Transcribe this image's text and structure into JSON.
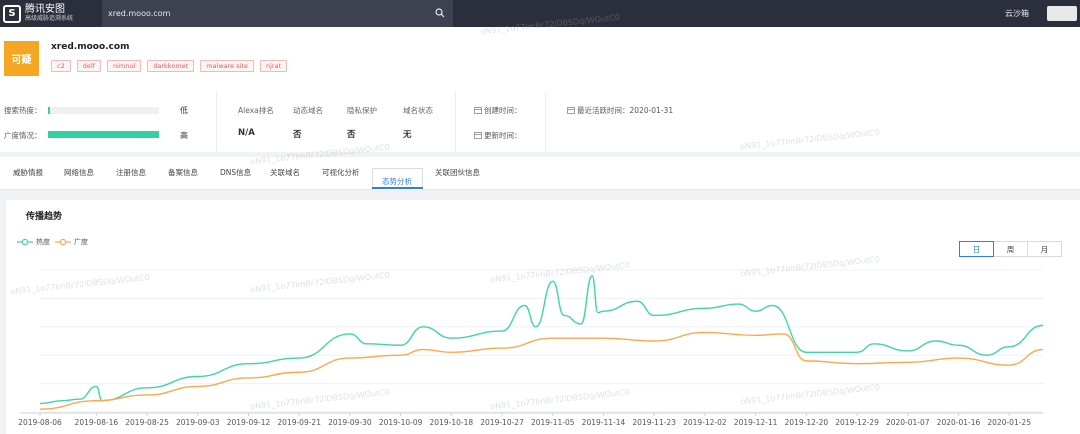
{
  "app": {
    "brand_mark": "S",
    "brand_name": "腾讯安图",
    "brand_sub": "高级威胁追溯系统",
    "search_value": "xred.mooo.com",
    "user_name": "云沙箱"
  },
  "header": {
    "verdict": "可疑",
    "domain": "xred.mooo.com",
    "tags": [
      "c2",
      "delf",
      "nimnul",
      "darkkomet",
      "malware site",
      "njrat"
    ]
  },
  "stats": {
    "search_heat_label": "搜索热度：",
    "search_heat_level": "低",
    "search_heat_fraction": 0.02,
    "spread_label": "广度情况：",
    "spread_level": "高",
    "spread_fraction": 1.0,
    "columns": [
      {
        "head": "Alexa排名",
        "value": "N/A"
      },
      {
        "head": "动态域名",
        "value": "否"
      },
      {
        "head": "隐私保护",
        "value": "否"
      },
      {
        "head": "域名状态",
        "value": "无"
      }
    ],
    "created_label": "创建时间：",
    "updated_label": "更新时间：",
    "last_active_label": "最近活跃时间：2020-01-31"
  },
  "tabs": [
    "威胁情报",
    "网络信息",
    "注册信息",
    "备案信息",
    "DNS信息",
    "关联域名",
    "可视化分析",
    "态势分析",
    "关联团伙信息"
  ],
  "active_tab": "态势分析",
  "panel": {
    "title": "传播趋势",
    "switch": [
      "日",
      "周",
      "月"
    ],
    "switch_active": "日"
  },
  "watermark": "oN91_1o77ImBr72lDBSDq/WOutC0",
  "colors": {
    "heat": "#3dd6a4",
    "breadth": "#ffa64d",
    "accent": "#2f7fe0",
    "verdict": "#f5a623"
  },
  "chart_data": {
    "type": "line",
    "x_ticks": [
      "2019-08-06",
      "2019-08-16",
      "2019-08-25",
      "2019-09-03",
      "2019-09-12",
      "2019-09-21",
      "2019-09-30",
      "2019-10-09",
      "2019-10-18",
      "2019-10-27",
      "2019-11-05",
      "2019-11-14",
      "2019-11-23",
      "2019-12-02",
      "2019-12-11",
      "2019-12-20",
      "2019-12-29",
      "2020-01-07",
      "2020-01-16",
      "2020-01-25"
    ],
    "x_start": "2019-08-06",
    "x_end": "2020-01-31",
    "grid": true,
    "ylim": [
      0,
      100
    ],
    "legend_position": "top-left",
    "series": [
      {
        "name": "热度",
        "color": "#3dd6a4",
        "points": [
          [
            "2019-08-06",
            6
          ],
          [
            "2019-08-10",
            8
          ],
          [
            "2019-08-13",
            9
          ],
          [
            "2019-08-16",
            18
          ],
          [
            "2019-08-17",
            8
          ],
          [
            "2019-08-25",
            17
          ],
          [
            "2019-09-03",
            25
          ],
          [
            "2019-09-12",
            34
          ],
          [
            "2019-09-21",
            38
          ],
          [
            "2019-09-30",
            55
          ],
          [
            "2019-10-03",
            48
          ],
          [
            "2019-10-09",
            47
          ],
          [
            "2019-10-13",
            60
          ],
          [
            "2019-10-18",
            52
          ],
          [
            "2019-10-27",
            57
          ],
          [
            "2019-10-31",
            75
          ],
          [
            "2019-11-02",
            60
          ],
          [
            "2019-11-05",
            92
          ],
          [
            "2019-11-07",
            68
          ],
          [
            "2019-11-10",
            62
          ],
          [
            "2019-11-12",
            96
          ],
          [
            "2019-11-13",
            70
          ],
          [
            "2019-11-14",
            71
          ],
          [
            "2019-11-20",
            78
          ],
          [
            "2019-11-23",
            68
          ],
          [
            "2019-12-02",
            73
          ],
          [
            "2019-12-08",
            76
          ],
          [
            "2019-12-11",
            71
          ],
          [
            "2019-12-14",
            75
          ],
          [
            "2019-12-20",
            42
          ],
          [
            "2019-12-29",
            42
          ],
          [
            "2020-01-01",
            48
          ],
          [
            "2020-01-07",
            43
          ],
          [
            "2020-01-12",
            50
          ],
          [
            "2020-01-16",
            47
          ],
          [
            "2020-01-21",
            40
          ],
          [
            "2020-01-25",
            46
          ],
          [
            "2020-01-31",
            61
          ]
        ]
      },
      {
        "name": "广度",
        "color": "#ffa64d",
        "points": [
          [
            "2019-08-06",
            2
          ],
          [
            "2019-08-16",
            8
          ],
          [
            "2019-08-25",
            12
          ],
          [
            "2019-09-03",
            18
          ],
          [
            "2019-09-12",
            24
          ],
          [
            "2019-09-21",
            28
          ],
          [
            "2019-09-30",
            38
          ],
          [
            "2019-10-09",
            40
          ],
          [
            "2019-10-13",
            44
          ],
          [
            "2019-10-18",
            42
          ],
          [
            "2019-10-27",
            45
          ],
          [
            "2019-11-05",
            52
          ],
          [
            "2019-11-14",
            52
          ],
          [
            "2019-11-23",
            50
          ],
          [
            "2019-12-02",
            56
          ],
          [
            "2019-12-11",
            54
          ],
          [
            "2019-12-16",
            55
          ],
          [
            "2019-12-20",
            36
          ],
          [
            "2019-12-29",
            34
          ],
          [
            "2020-01-07",
            35
          ],
          [
            "2020-01-16",
            38
          ],
          [
            "2020-01-25",
            33
          ],
          [
            "2020-01-31",
            44
          ]
        ]
      }
    ]
  }
}
